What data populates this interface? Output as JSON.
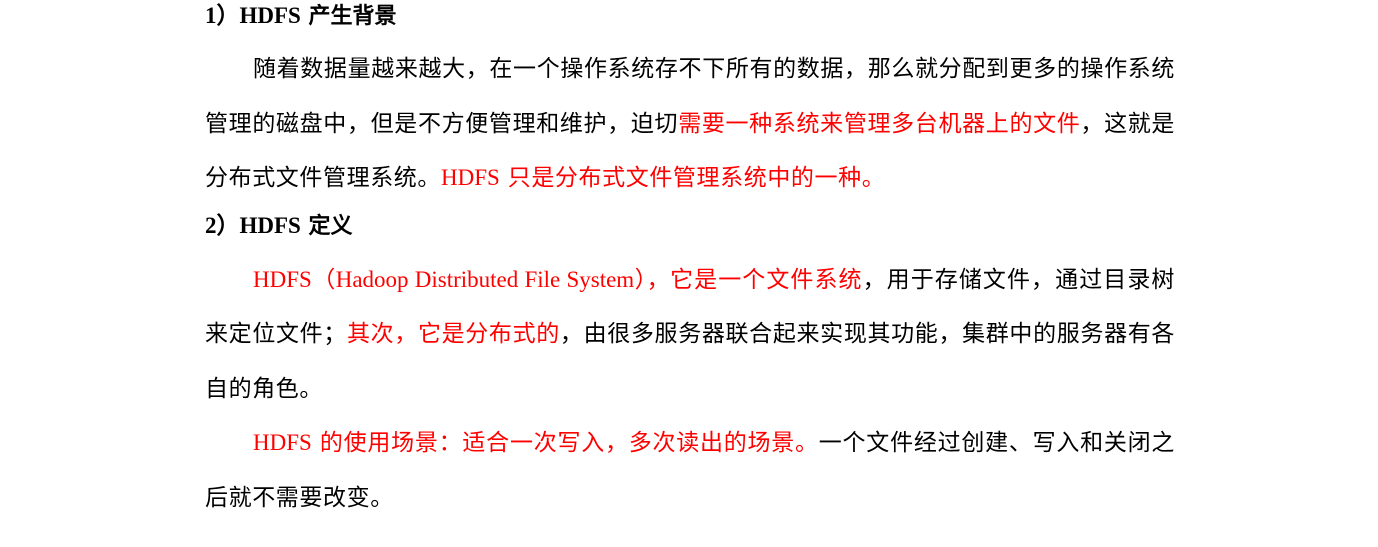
{
  "section1": {
    "number": "1）",
    "title_latin": "HDFS",
    "title_cjk": " 产生背景",
    "para": {
      "part1": "随着数据量越来越大，在一个操作系统存不下所有的数据，那么就分配到更多的操作系统管理的磁盘中，但是不方便管理和维护，迫切",
      "part2_red": "需要一种系统来管理多台机器上的文件",
      "part3": "，这就是分布式文件管理系统。",
      "part4_red_latin": "HDFS",
      "part5_red": " 只是分布式文件管理系统中的一种。"
    }
  },
  "section2": {
    "number": "2）",
    "title_latin": "HDFS",
    "title_cjk": " 定义",
    "para1": {
      "part1_red_latin": "HDFS（Hadoop Distributed File System），",
      "part2_red": "它是一个文件系统",
      "part3": "，用于存储文件，通过目录树来定位文件；",
      "part4_red": "其次，它是分布式的",
      "part5": "，由很多服务器联合起来实现其功能，集群中的服务器有各自的角色。"
    },
    "para2": {
      "part1_red_latin": "HDFS",
      "part2_red": " 的使用场景：适合一次写入，多次读出的场景。",
      "part3": "一个文件经过创建、写入和关闭之后就不需要改变。"
    }
  },
  "colors": {
    "text": "#000000",
    "highlight": "#ff0000",
    "background": "#ffffff"
  }
}
